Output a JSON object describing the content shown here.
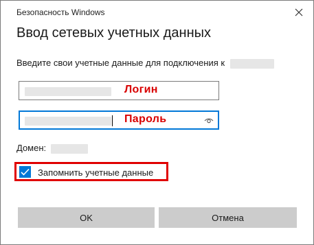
{
  "window": {
    "title": "Безопасность Windows",
    "close_icon": "close-icon"
  },
  "heading": "Ввод сетевых учетных данных",
  "prompt": "Введите свои учетные данные для подключения к",
  "username_field": {
    "annotation": "Логин"
  },
  "password_field": {
    "annotation": "Пароль",
    "reveal_icon": "eye-icon"
  },
  "domain_label": "Домен:",
  "remember": {
    "label": "Запомнить учетные данные",
    "checked": true
  },
  "buttons": {
    "ok": "OK",
    "cancel": "Отмена"
  },
  "colors": {
    "accent": "#0078d7",
    "annotation_red": "#e00000",
    "button_bg": "#cccccc"
  }
}
